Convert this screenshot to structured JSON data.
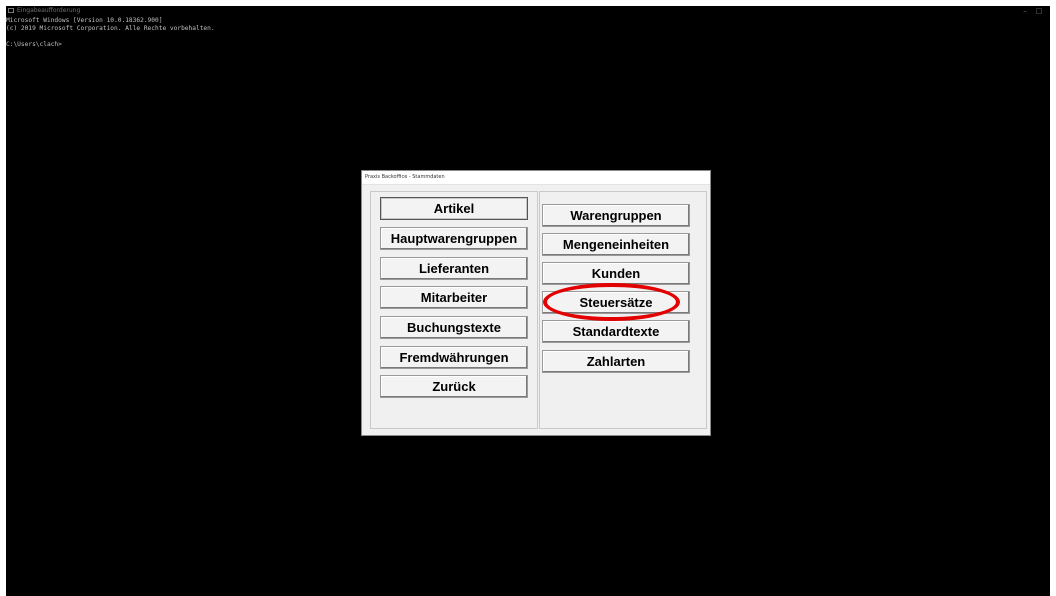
{
  "console": {
    "title": "Eingabeaufforderung",
    "controls": {
      "minimize": "–",
      "maximize": "□"
    },
    "lines": [
      "Microsoft Windows [Version 10.0.18362.900]",
      "(c) 2019 Microsoft Corporation. Alle Rechte vorbehalten.",
      "",
      "C:\\Users\\clach>"
    ]
  },
  "dialog": {
    "title": "Praxis Backoffice - Stammdaten",
    "left_buttons": [
      "Artikel",
      "Hauptwarengruppen",
      "Lieferanten",
      "Mitarbeiter",
      "Buchungstexte",
      "Fremdwährungen",
      "Zurück"
    ],
    "right_buttons": [
      "Warengruppen",
      "Mengeneinheiten",
      "Kunden",
      "Steuersätze",
      "Standardtexte",
      "Zahlarten"
    ]
  },
  "annotation": {
    "highlight_color": "#e30000"
  }
}
